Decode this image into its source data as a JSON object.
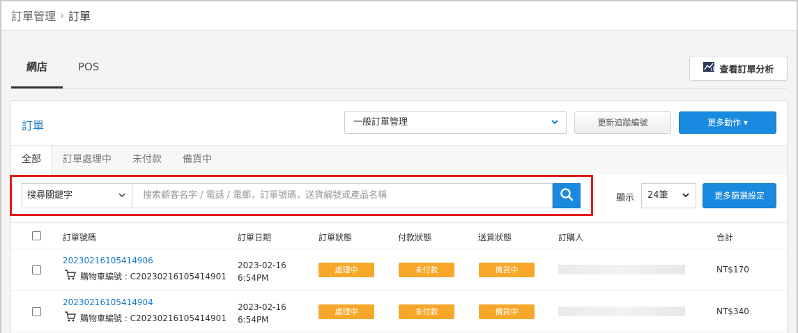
{
  "breadcrumb": {
    "parent": "訂單管理",
    "separator": "›",
    "current": "訂單"
  },
  "channel_tabs": [
    {
      "label": "網店",
      "active": true
    },
    {
      "label": "POS",
      "active": false
    }
  ],
  "analysis_button": {
    "label": "查看訂單分析",
    "icon": "chart-icon"
  },
  "panel": {
    "title": "訂單",
    "management_select": {
      "value": "一般訂單管理"
    },
    "update_tracking_button": "更新追蹤編號",
    "more_actions_button": "更多動作 ▾"
  },
  "status_tabs": [
    "全部",
    "訂單處理中",
    "未付款",
    "備貨中"
  ],
  "search": {
    "keyword_select": "搜尋關鍵字",
    "placeholder": "搜索顧客名字 / 電話 / 電郵，訂單號碼，送貨編號或產品名稱",
    "show_label": "顯示",
    "per_page": "24筆",
    "more_filters_button": "更多篩選設定"
  },
  "table": {
    "headers": [
      "訂單號碼",
      "訂單日期",
      "訂單狀態",
      "付款狀態",
      "送貨狀態",
      "訂購人",
      "合計"
    ],
    "rows": [
      {
        "order_no": "20230216105414906",
        "cart_label": "購物車編號 : C20230216105414901",
        "date": "2023-02-16",
        "time": "6:54PM",
        "order_status": "處理中",
        "payment_status": "未付款",
        "delivery_status": "備貨中",
        "total": "NT$170"
      },
      {
        "order_no": "20230216105414904",
        "cart_label": "購物車編號 : C20230216105414901",
        "date": "2023-02-16",
        "time": "6:54PM",
        "order_status": "處理中",
        "payment_status": "未付款",
        "delivery_status": "備貨中",
        "total": "NT$340"
      }
    ]
  },
  "colors": {
    "accent": "#1a8ae0",
    "link": "#1a7bc9",
    "badge": "#f7a72a",
    "highlight": "#e21b1b"
  }
}
